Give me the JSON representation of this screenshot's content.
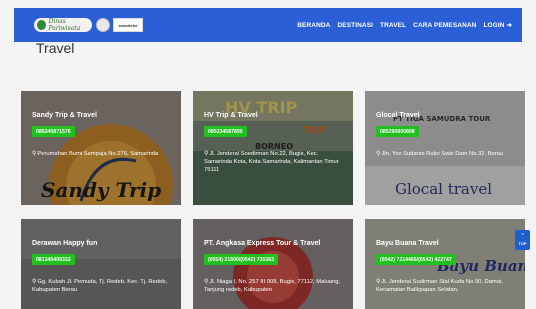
{
  "navbar": {
    "logo_text": "Dinas Pariwisata",
    "wonderful_text": "wonderful",
    "links": [
      "BERANDA",
      "DESTINASI",
      "TRAVEL",
      "CARA PEMESANAN",
      "LOGIN"
    ],
    "login_icon": "sign-in-icon"
  },
  "page": {
    "title": "Travel"
  },
  "cards": [
    {
      "name": "Sandy Trip & Travel",
      "phone": "085345871576",
      "address": "Perumahan Bumi Sempaja No.276, Samarinda",
      "bg_text": "Sandy Trip"
    },
    {
      "name": "HV Trip & Travel",
      "phone": "085234587890",
      "address": "Jl. Jenderal Soedirman No.22, Bugis, Kec. Samarinda Kota, Kota Samarinda, Kalimantan Timur 75111",
      "bg_text": "BORNEO"
    },
    {
      "name": "Glocal Travel",
      "phone": "085290900808",
      "address": "Jln. Yos Sudarso Ruko Swis Dam No.32, Berau",
      "bg_text": "Glocal travel"
    },
    {
      "name": "Derawan Happy fun",
      "phone": "081345409333",
      "address": "Gg. Kubah Jl. Pemuda, Tj. Redeb, Kec. Tj. Redeb, Kabupaten Berau",
      "bg_text": ""
    },
    {
      "name": "PT. Angkasa Express Tour & Travel",
      "phone": "(0554) 21600/(0542) 735363",
      "address": "Jl. Niaga I, No. 257 III 008, Bugis, 77112, Maluang, Tanjung redeb, Kabupaten",
      "bg_text": ""
    },
    {
      "name": "Bayu Buana Travel",
      "phone": "(0542) 7214466/(0542) 422747",
      "address": "Jl. Jenderal Sudirman Stal Kuda No.90, Damai, Kecamatan Balikpapan Selatan,",
      "bg_text": "Bayu Buana"
    }
  ],
  "back_to_top": {
    "label": "TOP"
  },
  "colors": {
    "navbar": "#2c5fd6",
    "phone_badge": "#22c01f"
  }
}
